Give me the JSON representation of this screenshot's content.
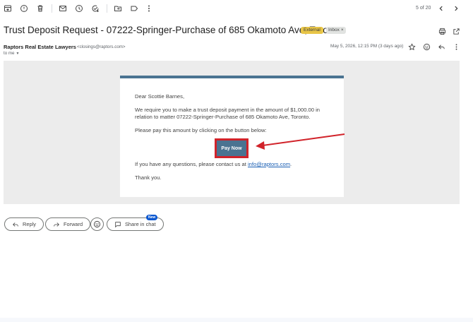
{
  "toolbar": {
    "icons": [
      "archive-icon",
      "report-spam-icon",
      "delete-icon",
      "mark-unread-icon",
      "snooze-icon",
      "add-to-tasks-icon",
      "move-to-icon",
      "labels-icon",
      "more-icon"
    ],
    "counter": "5 of 20"
  },
  "subject": "Trust Deposit Request - 07222-Springer-Purchase of 685 Okamoto Ave, Toronto",
  "labels": {
    "external": "External",
    "inbox": "Inbox",
    "inbox_remove": "×"
  },
  "sender": {
    "name": "Raptors Real Estate Lawyers",
    "email": "<closings@raptors.com>",
    "to": "to me",
    "to_caret": "▼",
    "date": "May 5, 2026, 12:15 PM (3 days ago)"
  },
  "email": {
    "greeting": "Dear Scottie Barnes,",
    "para1": "We require you to make a trust deposit payment in the amount of $1,000.00 in relation to matter 07222-Springer-Purchase of 685 Okamoto Ave, Toronto.",
    "para2": "Please pay this amount by clicking on the button below:",
    "pay_button": "Pay Now",
    "para3_prefix": "If you have any questions, please contact us at ",
    "contact_link": "info@raptors.com",
    "para3_suffix": ".",
    "closing": "Thank you.",
    "accent_color": "#4a7391",
    "highlight_color": "#d1232a"
  },
  "actions": {
    "reply": "Reply",
    "forward": "Forward",
    "share": "Share in chat",
    "new_badge": "New"
  }
}
